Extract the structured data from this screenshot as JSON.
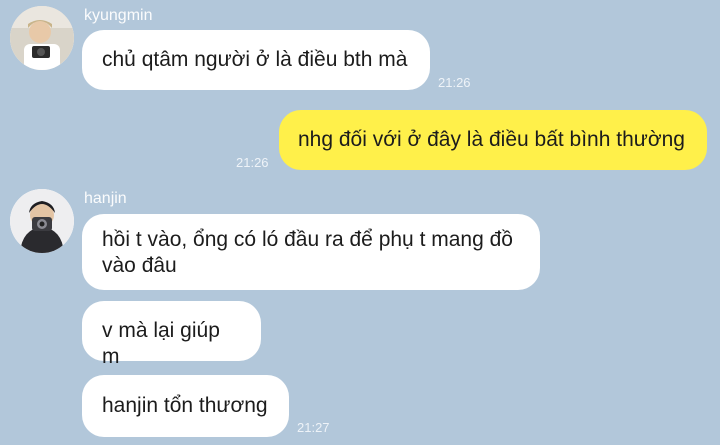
{
  "chat": {
    "messages": [
      {
        "sender": "kyungmin",
        "text": "chủ qtâm người ở là điều bth mà",
        "time": "21:26"
      },
      {
        "sender": "me",
        "text": "nhg đối với ở đây là điều bất bình thường",
        "time": "21:26"
      },
      {
        "sender": "hanjin",
        "text": "hồi t vào, ổng có ló đầu ra để phụ t mang đồ vào đâu"
      },
      {
        "sender": "hanjin",
        "text": "v mà lại giúp m"
      },
      {
        "sender": "hanjin",
        "text": "hanjin tổn thương",
        "time": "21:27"
      }
    ]
  },
  "colors": {
    "background": "#b2c7da",
    "incoming_bubble": "#ffffff",
    "outgoing_bubble": "#fff04a"
  }
}
